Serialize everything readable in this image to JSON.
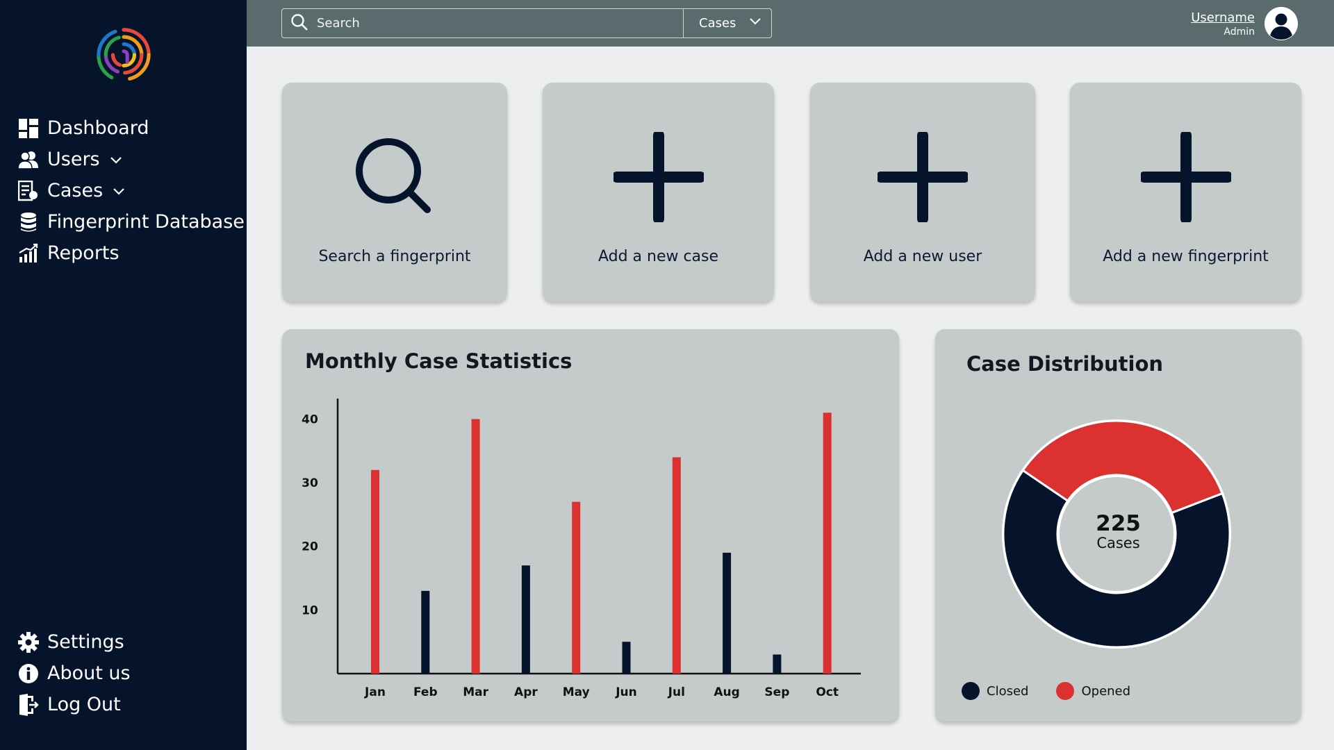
{
  "sidebar": {
    "items": [
      {
        "label": "Dashboard",
        "icon": "dashboard-icon"
      },
      {
        "label": "Users",
        "icon": "users-icon",
        "has_submenu": true
      },
      {
        "label": "Cases",
        "icon": "cases-icon",
        "has_submenu": true
      },
      {
        "label": "Fingerprint Database",
        "icon": "database-icon"
      },
      {
        "label": "Reports",
        "icon": "reports-icon"
      }
    ],
    "bottom_items": [
      {
        "label": "Settings",
        "icon": "gear-icon"
      },
      {
        "label": "About us",
        "icon": "info-icon"
      },
      {
        "label": "Log Out",
        "icon": "logout-icon"
      }
    ]
  },
  "topbar": {
    "search_placeholder": "Search",
    "search_scope": "Cases",
    "username": "Username",
    "role": "Admin"
  },
  "quick_actions": [
    {
      "label": "Search a fingerprint",
      "icon": "search-icon"
    },
    {
      "label": "Add a new case",
      "icon": "plus-icon"
    },
    {
      "label": "Add a new user",
      "icon": "plus-icon"
    },
    {
      "label": "Add a new fingerprint",
      "icon": "plus-icon"
    }
  ],
  "monthly_panel": {
    "title": "Monthly Case Statistics"
  },
  "distribution_panel": {
    "title": "Case Distribution",
    "total": "225",
    "total_label": "Cases"
  },
  "colors": {
    "sidebar_bg": "#06142b",
    "topbar_bg": "#5a6b6d",
    "card_bg": "#c5cacb",
    "navy": "#06142b",
    "red": "#dc3131"
  },
  "chart_data": [
    {
      "type": "bar",
      "title": "Monthly Case Statistics",
      "categories": [
        "Jan",
        "Feb",
        "Mar",
        "Apr",
        "May",
        "Jun",
        "Jul",
        "Aug",
        "Sep",
        "Oct"
      ],
      "values": [
        32,
        13,
        40,
        17,
        27,
        5,
        34,
        19,
        3,
        41
      ],
      "bar_colors": [
        "#dc3131",
        "#06142b",
        "#dc3131",
        "#06142b",
        "#dc3131",
        "#06142b",
        "#dc3131",
        "#06142b",
        "#06142b",
        "#dc3131"
      ],
      "yticks": [
        10,
        20,
        30,
        40
      ],
      "ylim": [
        0,
        43
      ],
      "grid": false
    },
    {
      "type": "pie",
      "title": "Case Distribution",
      "donut": true,
      "labels": [
        "Closed",
        "Opened"
      ],
      "values": [
        147,
        78
      ],
      "colors": [
        "#06142b",
        "#dc3131"
      ],
      "legend": "bottom-left"
    }
  ]
}
